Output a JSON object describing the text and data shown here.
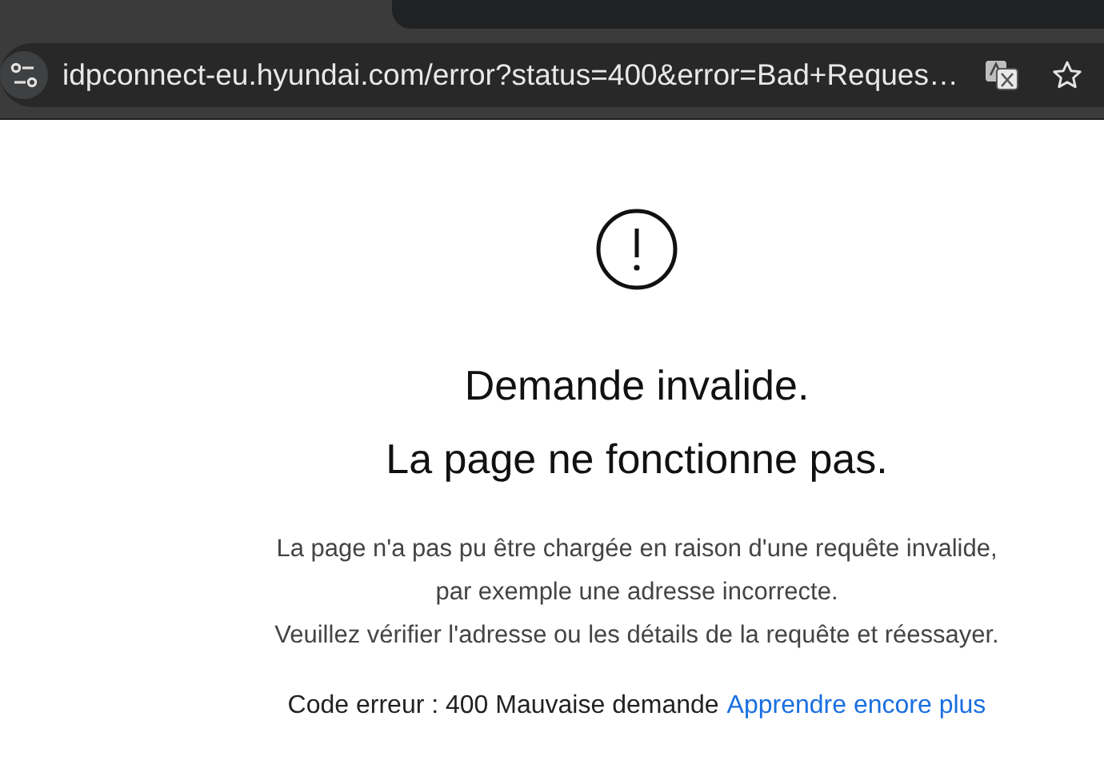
{
  "address_bar": {
    "url": "idpconnect-eu.hyundai.com/error?status=400&error=Bad+Reques…"
  },
  "error": {
    "title_lines": [
      "Demande invalide.",
      "La page ne fonctionne pas."
    ],
    "message_lines": [
      "La page n'a pas pu être chargée en raison d'une requête invalide,",
      "par exemple une adresse incorrecte.",
      "Veuillez vérifier l'adresse ou les détails de la requête et réessayer."
    ],
    "code": "Code erreur : 400 Mauvaise demande",
    "link": "Apprendre encore plus"
  }
}
